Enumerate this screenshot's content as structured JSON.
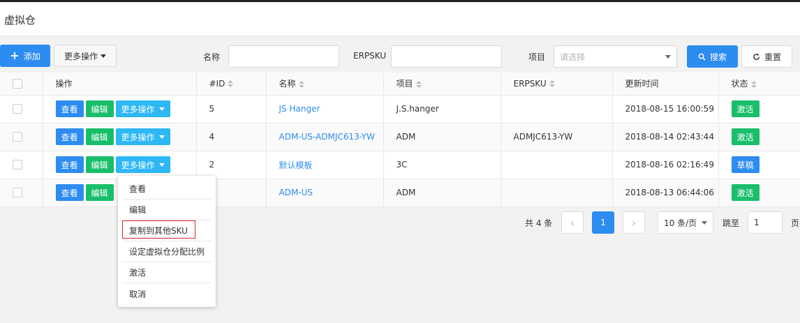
{
  "page": {
    "title": "虚拟仓"
  },
  "toolbar": {
    "add_label": "添加",
    "more_label": "更多操作",
    "name_label": "名称",
    "name_value": "",
    "erpsku_label": "ERPSKU",
    "erpsku_value": "",
    "project_label": "项目",
    "project_placeholder": "请选择",
    "search_label": "搜索",
    "reset_label": "重置"
  },
  "table": {
    "headers": [
      "操作",
      "#ID",
      "名称",
      "项目",
      "ERPSKU",
      "更新时间",
      "状态"
    ],
    "row_buttons": {
      "view": "查看",
      "edit": "编辑",
      "more": "更多操作"
    },
    "rows": [
      {
        "id": "5",
        "name": "JS Hanger",
        "project": "J.S.hanger",
        "erpsku": "",
        "updated": "2018-08-15 16:00:59",
        "status": "激活"
      },
      {
        "id": "4",
        "name": "ADM-US-ADMJC613-YW",
        "project": "ADM",
        "erpsku": "ADMJC613-YW",
        "updated": "2018-08-14 02:43:44",
        "status": "激活"
      },
      {
        "id": "2",
        "name": "默认模板",
        "project": "3C",
        "erpsku": "",
        "updated": "2018-08-16 02:16:49",
        "status": "草稿"
      },
      {
        "id": "",
        "name": "ADM-US",
        "project": "ADM",
        "erpsku": "",
        "updated": "2018-08-13 06:44:06",
        "status": "激活"
      }
    ]
  },
  "pagination": {
    "total": "共 4 条",
    "prev": "‹",
    "current": "1",
    "next": "›",
    "page_size": "10 条/页",
    "jump_label": "跳至",
    "jump_value": "1",
    "page_suffix": "页"
  },
  "dropdown": {
    "items": [
      "查看",
      "编辑",
      "复制到其他SKU",
      "设定虚拟仓分配比例",
      "激活",
      "取消"
    ]
  },
  "colors": {
    "primary": "#2d8cf0",
    "success": "#19be6b",
    "info": "#2db7f5",
    "highlight": "#d9262b"
  }
}
